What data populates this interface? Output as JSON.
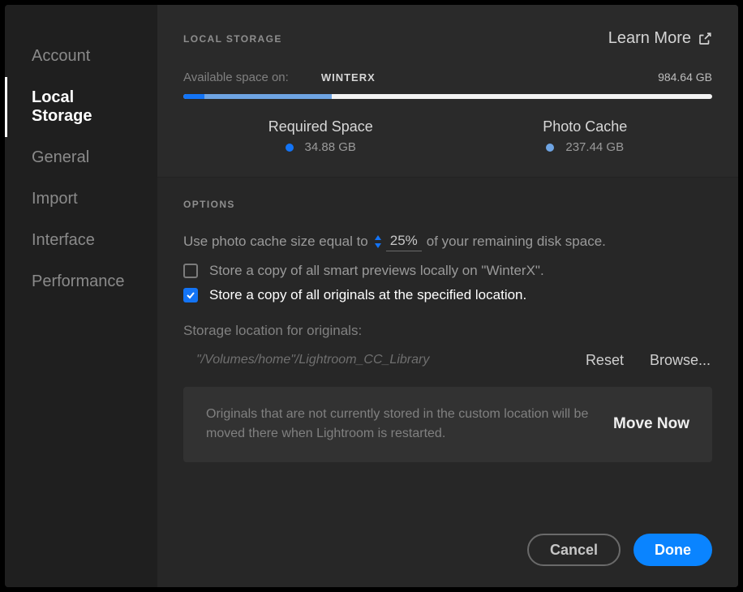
{
  "sidebar": {
    "items": [
      {
        "label": "Account"
      },
      {
        "label": "Local Storage"
      },
      {
        "label": "General"
      },
      {
        "label": "Import"
      },
      {
        "label": "Interface"
      },
      {
        "label": "Performance"
      }
    ],
    "active_index": 1
  },
  "storage": {
    "section_title": "LOCAL STORAGE",
    "learn_more_label": "Learn More",
    "available_label": "Available space on:",
    "drive_name": "WINTERX",
    "available_size": "984.64 GB",
    "required": {
      "label": "Required Space",
      "value": "34.88 GB"
    },
    "cache": {
      "label": "Photo Cache",
      "value": "237.44 GB"
    }
  },
  "options": {
    "section_title": "OPTIONS",
    "cache_line_prefix": "Use photo cache size equal to",
    "cache_percent": "25%",
    "cache_line_suffix": "of your remaining disk space.",
    "smart_previews_checked": false,
    "smart_previews_label": "Store a copy of all smart previews locally on \"WinterX\".",
    "originals_checked": true,
    "originals_label": "Store a copy of all originals at the specified location.",
    "storage_location_label": "Storage location for originals:",
    "storage_path": "\"/Volumes/home\"/Lightroom_CC_Library",
    "reset_label": "Reset",
    "browse_label": "Browse...",
    "info_text": "Originals that are not currently stored in the custom location will be moved there when Lightroom is restarted.",
    "move_now_label": "Move Now"
  },
  "footer": {
    "cancel_label": "Cancel",
    "done_label": "Done"
  }
}
